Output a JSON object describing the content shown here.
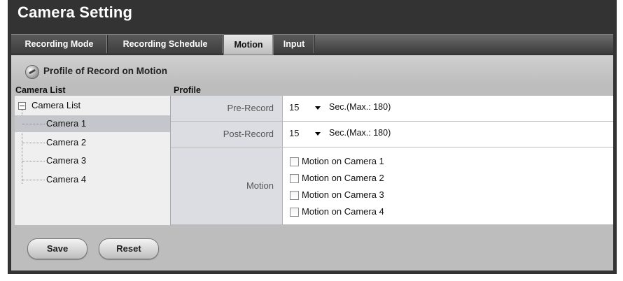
{
  "header": {
    "title": "Camera Setting"
  },
  "tabs": [
    {
      "label": "Recording Mode"
    },
    {
      "label": "Recording Schedule"
    },
    {
      "label": "Motion"
    },
    {
      "label": "Input"
    }
  ],
  "active_tab": "Motion",
  "section": {
    "title": "Profile of Record on Motion"
  },
  "columns": {
    "camera_list": "Camera List",
    "profile": "Profile"
  },
  "tree": {
    "root": "Camera List",
    "items": [
      {
        "label": "Camera 1",
        "selected": true
      },
      {
        "label": "Camera 2",
        "selected": false
      },
      {
        "label": "Camera 3",
        "selected": false
      },
      {
        "label": "Camera 4",
        "selected": false
      }
    ]
  },
  "profile": {
    "pre_record": {
      "label": "Pre-Record",
      "value": "15",
      "unit": "Sec.(Max.: 180)"
    },
    "post_record": {
      "label": "Post-Record",
      "value": "15",
      "unit": "Sec.(Max.: 180)"
    },
    "motion": {
      "label": "Motion",
      "options": [
        {
          "label": "Motion on Camera 1",
          "checked": false
        },
        {
          "label": "Motion on Camera 2",
          "checked": false
        },
        {
          "label": "Motion on Camera 3",
          "checked": false
        },
        {
          "label": "Motion on Camera 4",
          "checked": false
        }
      ]
    }
  },
  "buttons": {
    "save": "Save",
    "reset": "Reset"
  }
}
